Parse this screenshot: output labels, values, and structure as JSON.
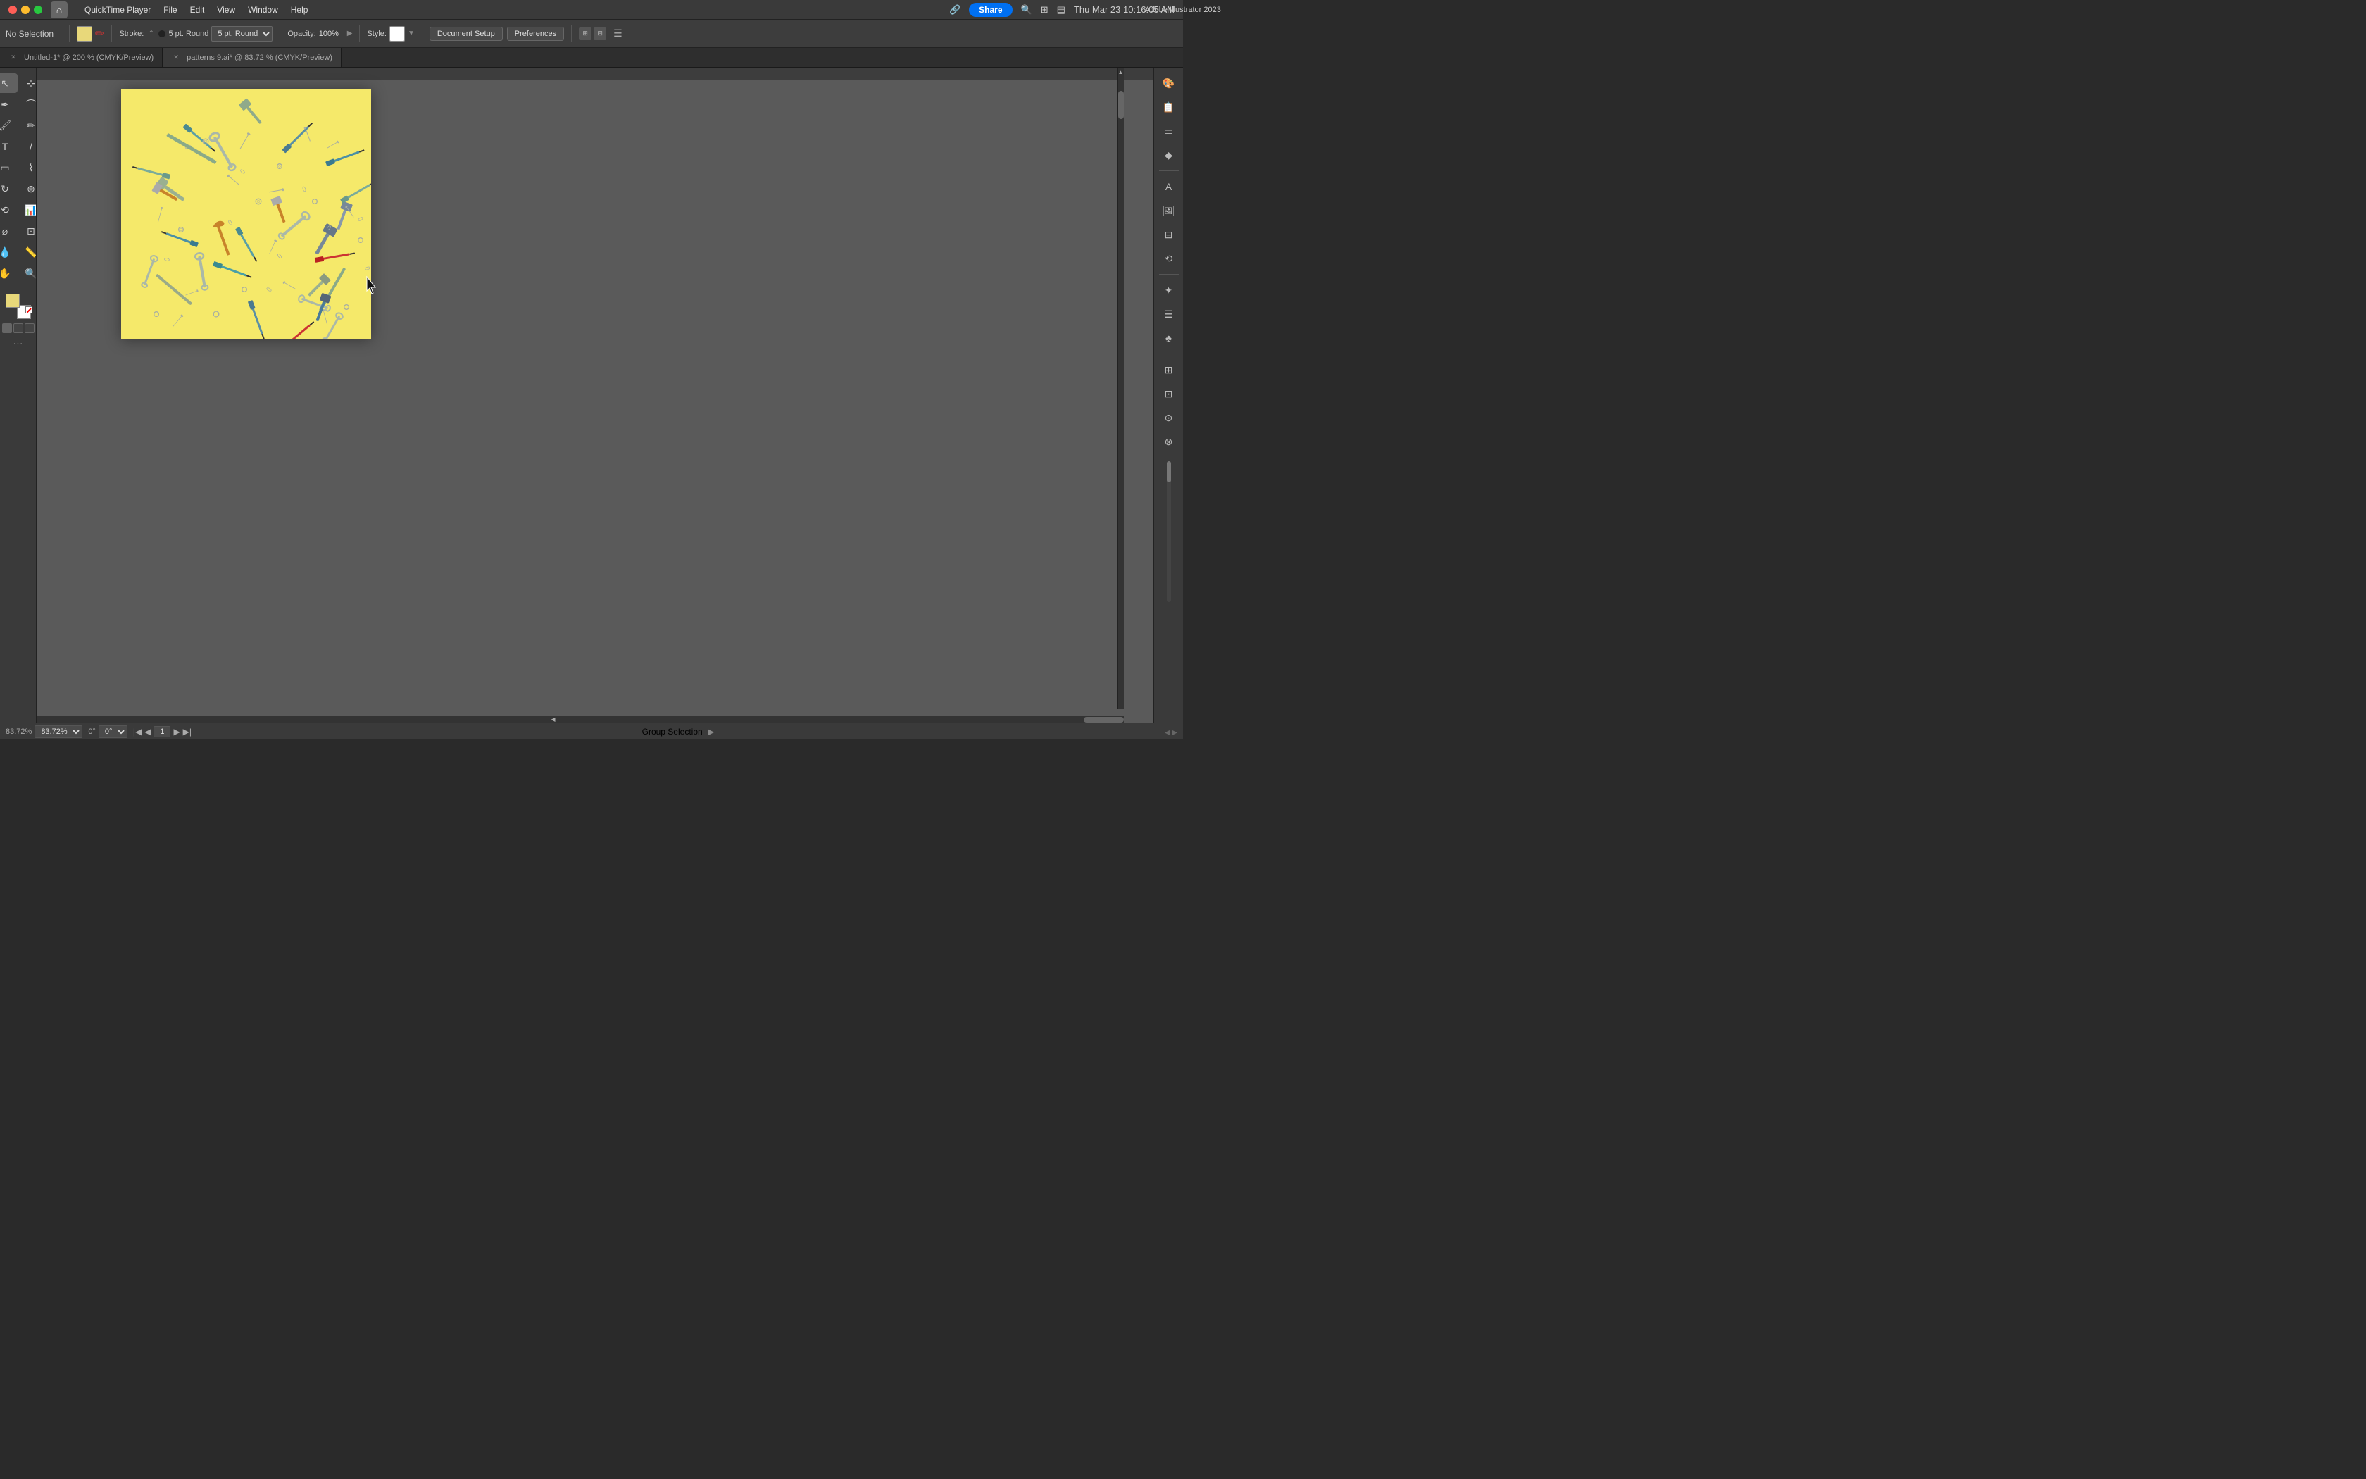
{
  "app": {
    "title": "Adobe Illustrator 2023",
    "window_title": "Adobe Illustrator 2023"
  },
  "mac": {
    "menu": [
      "QuickTime Player",
      "File",
      "Edit",
      "View",
      "Window",
      "Help"
    ],
    "time": "Thu Mar 23  10:16:05 AM"
  },
  "toolbar": {
    "no_selection": "No Selection",
    "stroke_label": "Stroke:",
    "stroke_value": "5 pt. Round",
    "opacity_label": "Opacity:",
    "opacity_value": "100%",
    "style_label": "Style:",
    "document_setup": "Document Setup",
    "preferences": "Preferences"
  },
  "tabs": [
    {
      "label": "Untitled-1* @ 200 % (CMYK/Preview)",
      "modified": true,
      "active": false
    },
    {
      "label": "patterns 9.ai* @ 83.72 % (CMYK/Preview)",
      "modified": true,
      "active": true
    }
  ],
  "status_bar": {
    "zoom": "83.72%",
    "angle": "0°",
    "page": "1",
    "group_selection": "Group Selection"
  },
  "right_panel": {
    "icons": [
      "palette",
      "layers",
      "artboard",
      "shape",
      "type",
      "image",
      "align",
      "transform",
      "appearance",
      "graphic_styles",
      "symbols",
      "brushes",
      "swatches",
      "color_guide",
      "document_info"
    ]
  }
}
